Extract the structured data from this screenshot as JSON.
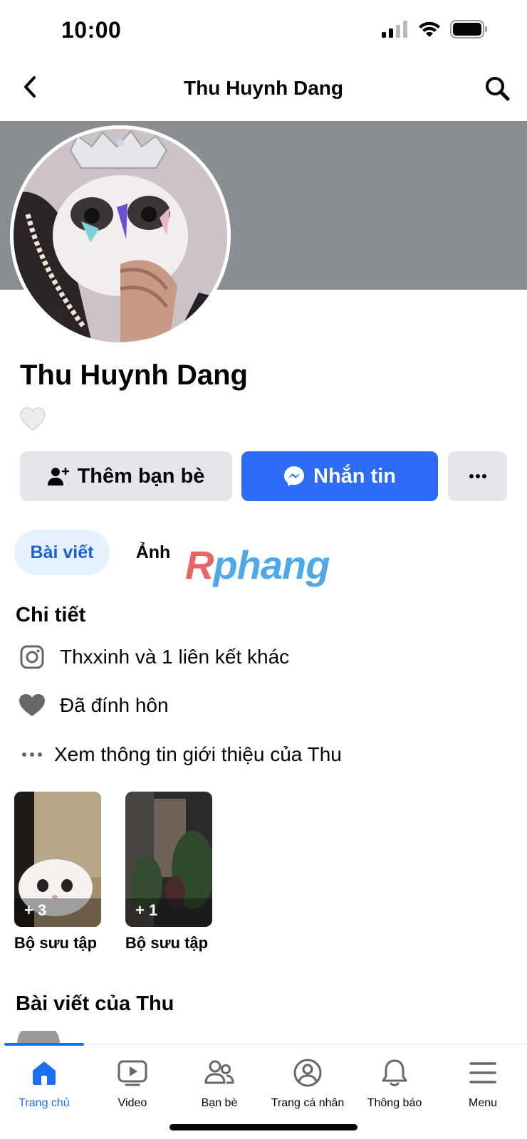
{
  "status_bar": {
    "time": "10:00"
  },
  "header": {
    "title": "Thu Huynh Dang"
  },
  "profile": {
    "name": "Thu Huynh Dang"
  },
  "actions": {
    "add_friend_label": "Thêm bạn bè",
    "message_label": "Nhắn tin"
  },
  "tabs": [
    {
      "label": "Bài viết",
      "active": true
    },
    {
      "label": "Ảnh",
      "active": false
    }
  ],
  "watermark": {
    "part1": "R",
    "part2": "phang"
  },
  "details": {
    "title": "Chi tiết",
    "items": [
      {
        "icon": "instagram-icon",
        "text": "Thxxinh và 1 liên kết khác"
      },
      {
        "icon": "heart-icon",
        "text": "Đã đính hôn"
      },
      {
        "icon": "more-dots-icon",
        "text": "Xem thông tin giới thiệu của Thu"
      }
    ]
  },
  "collections": [
    {
      "count": "+ 3",
      "caption": "Bộ sưu tập"
    },
    {
      "count": "+ 1",
      "caption": "Bộ sưu tập"
    }
  ],
  "posts_section": {
    "title": "Bài viết của Thu"
  },
  "bottom_nav": {
    "items": [
      {
        "label": "Trang chủ",
        "icon": "home-icon",
        "active": true
      },
      {
        "label": "Video",
        "icon": "video-icon",
        "active": false
      },
      {
        "label": "Bạn bè",
        "icon": "friends-icon",
        "active": false
      },
      {
        "label": "Trang cá nhân",
        "icon": "profile-icon",
        "active": false
      },
      {
        "label": "Thông báo",
        "icon": "bell-icon",
        "active": false
      },
      {
        "label": "Menu",
        "icon": "menu-icon",
        "active": false
      }
    ]
  },
  "colors": {
    "primary": "#2d6af5",
    "nav_active": "#1b6ef3",
    "cover_gray": "#8a8d91",
    "button_gray": "#e4e6eb"
  }
}
